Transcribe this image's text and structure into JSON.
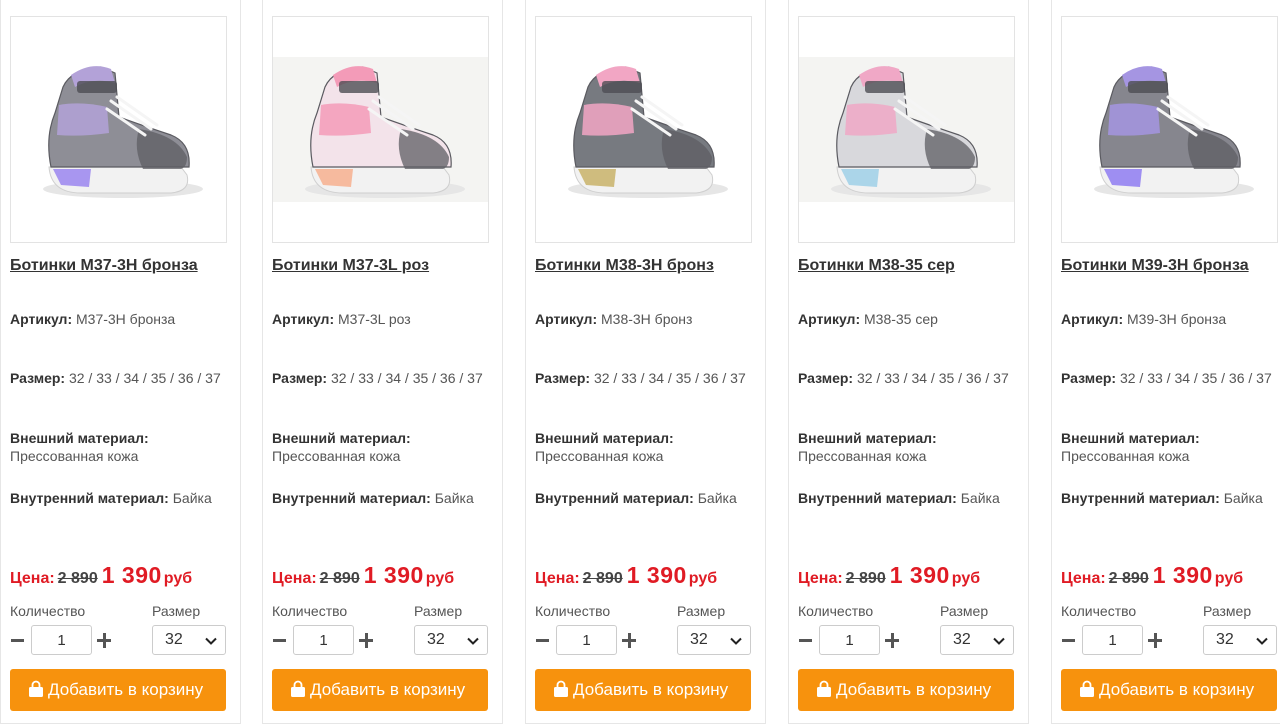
{
  "labels": {
    "article": "Артикул:",
    "size": "Размер:",
    "outer_material": "Внешний материал:",
    "inner_material": "Внутренний материал:",
    "price": "Цена:",
    "quantity": "Количество",
    "size_select": "Размер",
    "add_to_cart": "Добавить в корзину",
    "currency": "руб"
  },
  "colors": {
    "accent_orange": "#f7920d",
    "price_red": "#e01b24"
  },
  "icons": {
    "minus": "minus-icon",
    "plus": "plus-icon",
    "chevron": "chevron-down-icon",
    "bag": "shopping-bag-icon"
  },
  "products": [
    {
      "title": "Ботинки М37-3Н бронза",
      "article": "М37-3Н бронза",
      "sizes": "32 / 33 / 34 / 35 / 36 / 37",
      "outer_material": "Прессованная кожа",
      "inner_material": "Байка",
      "old_price": "2 890",
      "new_price": "1 390",
      "quantity": "1",
      "selected_size": "32",
      "shoe_colors": {
        "body": "#8e8e96",
        "accent": "#b3a2d8",
        "sole_light": "#9b86f0"
      }
    },
    {
      "title": "Ботинки М37-3L роз",
      "article": "М37-3L роз",
      "sizes": "32 / 33 / 34 / 35 / 36 / 37",
      "outer_material": "Прессованная кожа",
      "inner_material": "Байка",
      "old_price": "2 890",
      "new_price": "1 390",
      "quantity": "1",
      "selected_size": "32",
      "shoe_colors": {
        "body": "#f3e3ea",
        "accent": "#f39bb8",
        "sole_light": "#f7b08f"
      }
    },
    {
      "title": "Ботинки М38-3Н бронз",
      "article": "М38-3Н бронз",
      "sizes": "32 / 33 / 34 / 35 / 36 / 37",
      "outer_material": "Прессованная кожа",
      "inner_material": "Байка",
      "old_price": "2 890",
      "new_price": "1 390",
      "quantity": "1",
      "selected_size": "32",
      "shoe_colors": {
        "body": "#777a80",
        "accent": "#f2a6c4",
        "sole_light": "#c9b36a"
      }
    },
    {
      "title": "Ботинки М38-35 сер",
      "article": "М38-35 сер",
      "sizes": "32 / 33 / 34 / 35 / 36 / 37",
      "outer_material": "Прессованная кожа",
      "inner_material": "Байка",
      "old_price": "2 890",
      "new_price": "1 390",
      "quantity": "1",
      "selected_size": "32",
      "shoe_colors": {
        "body": "#d8d8dc",
        "accent": "#f0a8c6",
        "sole_light": "#9fd0e8"
      }
    },
    {
      "title": "Ботинки М39-3Н бронза",
      "article": "М39-3Н бронза",
      "sizes": "32 / 33 / 34 / 35 / 36 / 37",
      "outer_material": "Прессованная кожа",
      "inner_material": "Байка",
      "old_price": "2 890",
      "new_price": "1 390",
      "quantity": "1",
      "selected_size": "32",
      "shoe_colors": {
        "body": "#86868e",
        "accent": "#a595e2",
        "sole_light": "#8f7cf2"
      }
    }
  ]
}
